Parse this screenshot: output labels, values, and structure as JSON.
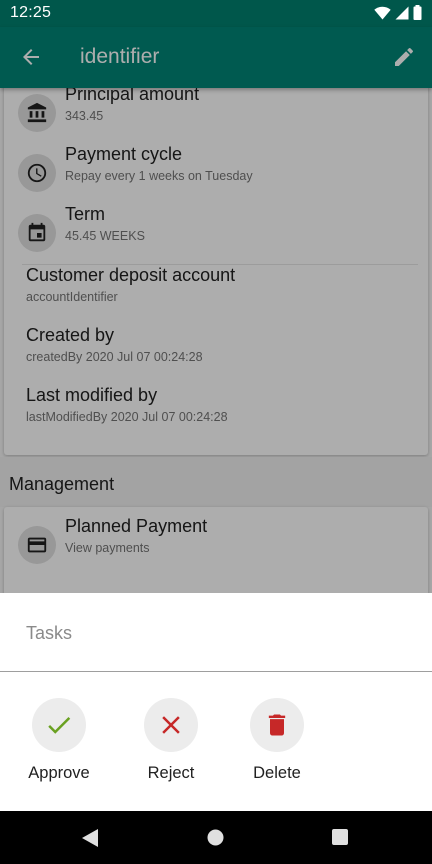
{
  "status": {
    "time": "12:25",
    "icons": [
      "wifi-icon",
      "signal-icon",
      "battery-icon"
    ]
  },
  "appbar": {
    "title": "identifier",
    "back_icon": "arrow-back-icon",
    "edit_icon": "pencil-icon"
  },
  "details": [
    {
      "icon": "bank-icon",
      "title": "Principal amount",
      "subtitle": "343.45"
    },
    {
      "icon": "clock-icon",
      "title": "Payment cycle",
      "subtitle": "Repay every 1 weeks on Tuesday"
    },
    {
      "icon": "calendar-icon",
      "title": "Term",
      "subtitle": "45.45 WEEKS"
    },
    {
      "title": "Customer deposit account",
      "subtitle": "accountIdentifier"
    },
    {
      "title": "Created by",
      "subtitle": "createdBy 2020 Jul 07 00:24:28"
    },
    {
      "title": "Last modified by",
      "subtitle": "lastModifiedBy 2020 Jul 07 00:24:28"
    }
  ],
  "management": {
    "header": "Management",
    "items": [
      {
        "icon": "credit-card-icon",
        "title": "Planned Payment",
        "subtitle": "View payments"
      }
    ]
  },
  "sheet": {
    "title": "Tasks",
    "actions": [
      {
        "label": "Approve",
        "icon": "check-icon",
        "color": "#6aa121"
      },
      {
        "label": "Reject",
        "icon": "close-icon",
        "color": "#c62828"
      },
      {
        "label": "Delete",
        "icon": "trash-icon",
        "color": "#c62828"
      }
    ]
  },
  "colors": {
    "primary": "#008577",
    "primary_dark": "#00574b",
    "approve": "#6aa121",
    "reject": "#c62828"
  },
  "navbar": {
    "icons": [
      "nav-back-icon",
      "nav-home-icon",
      "nav-recents-icon"
    ]
  }
}
